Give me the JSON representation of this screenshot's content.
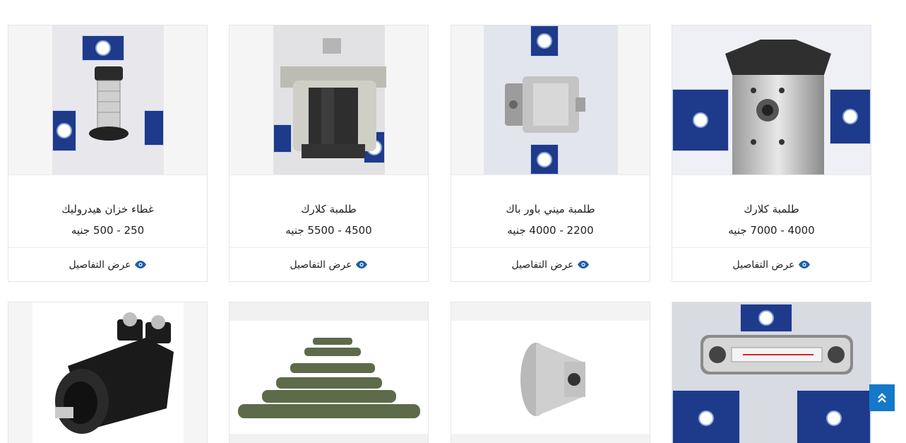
{
  "products": [
    {
      "title": "طلمبة كلارك",
      "price": "4000 - 7000 جنيه",
      "details_label": "عرض التفاصيل",
      "image_icon": "gear-pump-image"
    },
    {
      "title": "طلمبة ميني باور باك",
      "price": "2200 - 4000 جنيه",
      "details_label": "عرض التفاصيل",
      "image_icon": "mini-power-pack-pump-image"
    },
    {
      "title": "طلمبة كلارك",
      "price": "4500 - 5500 جنيه",
      "details_label": "عرض التفاصيل",
      "image_icon": "gear-pump-image"
    },
    {
      "title": "غطاء خزان هيدروليك",
      "price": "250 - 500 جنيه",
      "details_label": "عرض التفاصيل",
      "image_icon": "tank-cap-image"
    },
    {
      "image_icon": "level-gauge-image"
    },
    {
      "image_icon": "bell-housing-image"
    },
    {
      "image_icon": "oil-cooler-image"
    },
    {
      "image_icon": "hydraulic-motor-image"
    }
  ],
  "scroll_top_icon": "double-chevron-up-icon",
  "colors": {
    "accent": "#1479c9",
    "eye_icon": "#1b5fa8",
    "border": "#e6e6e6"
  }
}
